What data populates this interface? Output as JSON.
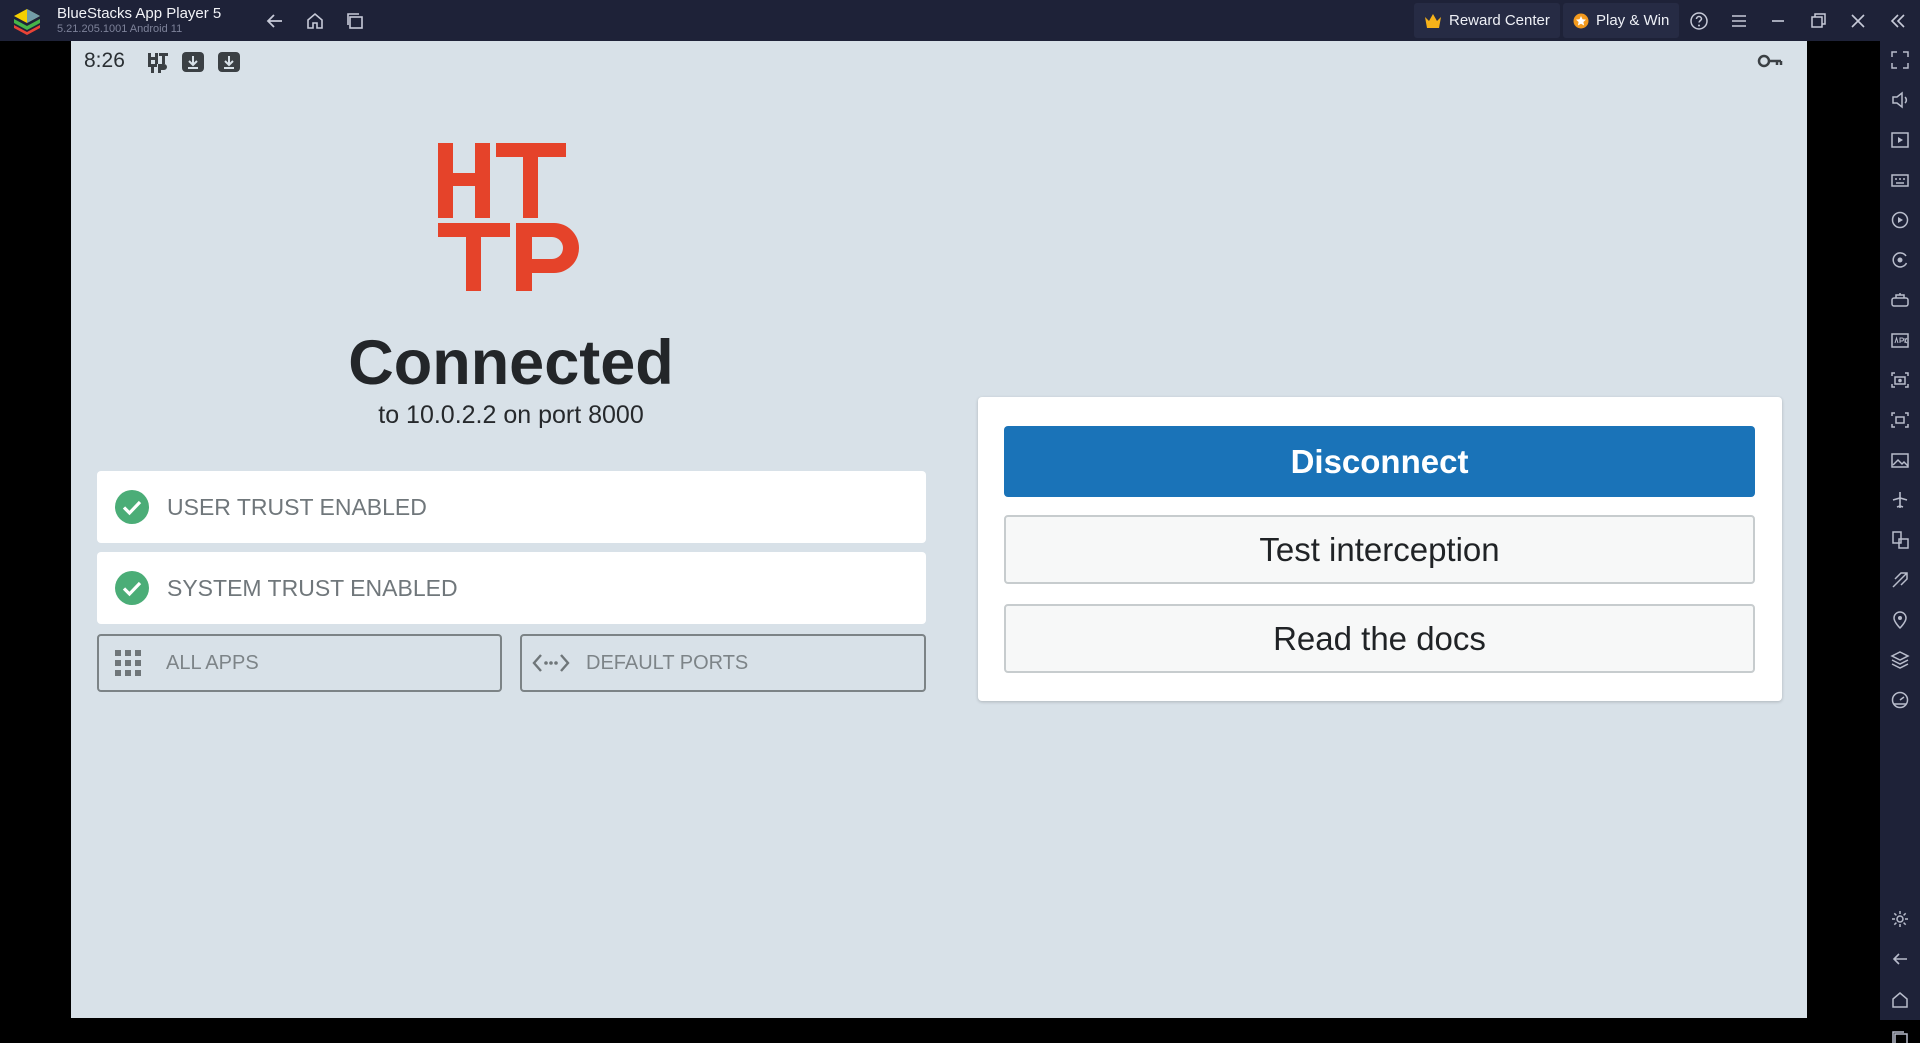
{
  "window": {
    "title": "BlueStacks App Player 5",
    "version": "5.21.205.1001  Android 11",
    "reward_center": "Reward Center",
    "play_win": "Play & Win"
  },
  "status_bar": {
    "time": "8:26"
  },
  "main": {
    "logo_text": "HTTP",
    "headline": "Connected",
    "subline": "to 10.0.2.2 on port 8000",
    "user_trust": "USER TRUST ENABLED",
    "system_trust": "SYSTEM TRUST ENABLED",
    "all_apps": "ALL APPS",
    "default_ports": "DEFAULT PORTS"
  },
  "actions": {
    "disconnect": "Disconnect",
    "test_interception": "Test interception",
    "read_docs": "Read the docs"
  },
  "colors": {
    "accent": "#1a73b8",
    "logo_red": "#e5432a",
    "check_green": "#4bad77",
    "chrome": "#1e2238"
  },
  "sidebar_icons": [
    "fullscreen-icon",
    "volume-icon",
    "media-icon",
    "keyboard-icon",
    "macro-icon",
    "sync-icon",
    "gamepad-icon",
    "apk-icon",
    "screenshot-icon",
    "record-icon",
    "gallery-icon",
    "airplane-icon",
    "multi-instance-icon",
    "eco-icon",
    "location-icon",
    "layers-icon",
    "performance-icon",
    "settings-icon",
    "back-icon",
    "home-icon",
    "recents-icon"
  ]
}
